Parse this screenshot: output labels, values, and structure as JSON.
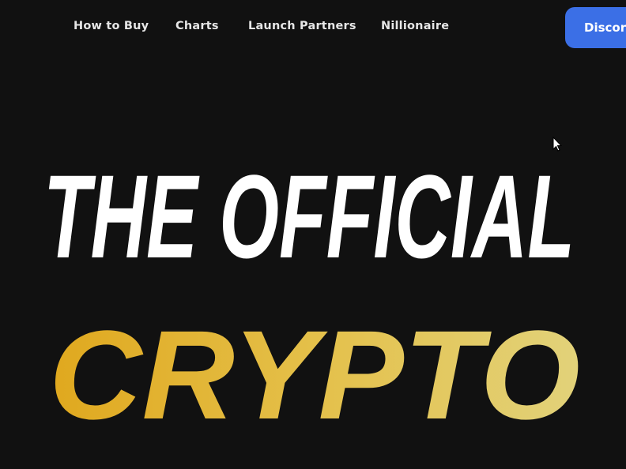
{
  "nav": {
    "links": [
      {
        "label": "How to Buy"
      },
      {
        "label": "Charts"
      },
      {
        "label": "Launch Partners"
      },
      {
        "label": "Nillionaire"
      }
    ],
    "cta_label": "Discord"
  },
  "hero": {
    "line1": "THE OFFICIAL",
    "line2": "CRYPTO"
  },
  "colors": {
    "background": "#111111",
    "cta": "#3b6fe6",
    "gold_dark": "#e0a81e",
    "gold_light": "#e2d27a"
  }
}
